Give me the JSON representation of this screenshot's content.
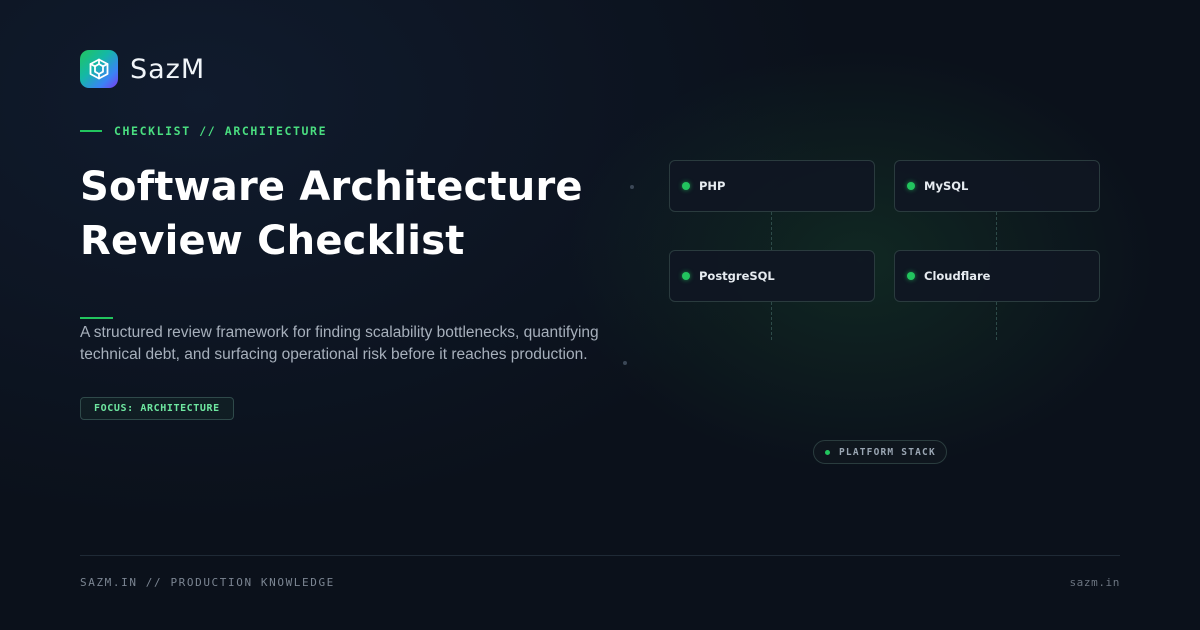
{
  "brand": {
    "name": "SazM",
    "logo_icon": "sazm-logo-icon"
  },
  "eyebrow": {
    "text": "CHECKLIST // ARCHITECTURE"
  },
  "title": {
    "line1": "Software Architecture",
    "line2": "Review Checklist"
  },
  "description": "A structured review framework for finding scalability bottlenecks, quantifying technical debt, and surfacing operational risk before it reaches production.",
  "focus_pill": "FOCUS: ARCHITECTURE",
  "stack": {
    "items": [
      {
        "label": "PHP"
      },
      {
        "label": "MySQL"
      },
      {
        "label": "PostgreSQL"
      },
      {
        "label": "Cloudflare"
      }
    ],
    "pill_label": "PLATFORM STACK"
  },
  "footer": {
    "left": "SAZM.IN // PRODUCTION KNOWLEDGE",
    "right": "sazm.in"
  },
  "colors": {
    "accent": "#22c55e",
    "background": "#0b111b",
    "text": "#ffffff",
    "muted": "#a7b0bc"
  }
}
